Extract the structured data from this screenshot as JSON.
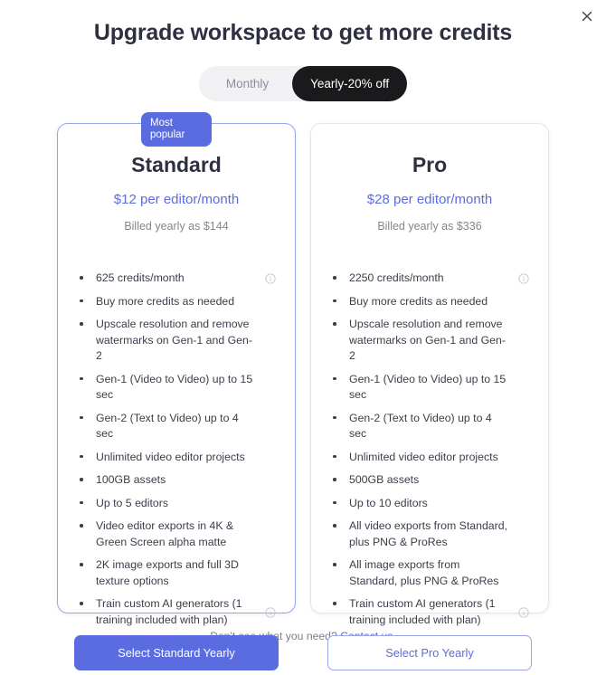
{
  "modal": {
    "title": "Upgrade workspace to get more credits",
    "close_icon": "close-icon"
  },
  "billing_toggle": {
    "monthly_label": "Monthly",
    "yearly_label": "Yearly-20% off",
    "selected": "yearly"
  },
  "plans": [
    {
      "id": "standard",
      "badge": "Most popular",
      "name": "Standard",
      "price": "$12 per editor/month",
      "billed": "Billed yearly as $144",
      "cta": "Select Standard Yearly",
      "features": [
        {
          "text": "625 credits/month",
          "info": true
        },
        {
          "text": "Buy more credits as needed",
          "info": false
        },
        {
          "text": "Upscale resolution and remove watermarks on Gen-1 and Gen-2",
          "info": false
        },
        {
          "text": "Gen-1 (Video to Video) up to 15 sec",
          "info": false
        },
        {
          "text": "Gen-2 (Text to Video) up to 4 sec",
          "info": false
        },
        {
          "text": "Unlimited video editor projects",
          "info": false
        },
        {
          "text": "100GB assets",
          "info": false
        },
        {
          "text": "Up to 5 editors",
          "info": false
        },
        {
          "text": "Video editor exports in 4K & Green Screen alpha matte",
          "info": false
        },
        {
          "text": "2K image exports and full 3D texture options",
          "info": false
        },
        {
          "text": "Train custom AI generators (1 training included with plan)",
          "info": true
        }
      ]
    },
    {
      "id": "pro",
      "badge": "",
      "name": "Pro",
      "price": "$28 per editor/month",
      "billed": "Billed yearly as $336",
      "cta": "Select Pro Yearly",
      "features": [
        {
          "text": "2250 credits/month",
          "info": true
        },
        {
          "text": "Buy more credits as needed",
          "info": false
        },
        {
          "text": "Upscale resolution and remove watermarks on Gen-1 and Gen-2",
          "info": false
        },
        {
          "text": "Gen-1 (Video to Video) up to 15 sec",
          "info": false
        },
        {
          "text": "Gen-2 (Text to Video) up to 4 sec",
          "info": false
        },
        {
          "text": "Unlimited video editor projects",
          "info": false
        },
        {
          "text": "500GB assets",
          "info": false
        },
        {
          "text": "Up to 10 editors",
          "info": false
        },
        {
          "text": "All video exports from Standard, plus PNG & ProRes",
          "info": false
        },
        {
          "text": "All image exports from Standard, plus PNG & ProRes",
          "info": false
        },
        {
          "text": "Train custom AI generators (1 training included with plan)",
          "info": true
        }
      ]
    }
  ],
  "footer": {
    "text": "Don't see what you need?",
    "link": "Contact us."
  },
  "colors": {
    "accent": "#5b6ce0",
    "title": "#2e3042",
    "muted": "#86868f",
    "toggle_active_bg": "#1a1a1c"
  }
}
